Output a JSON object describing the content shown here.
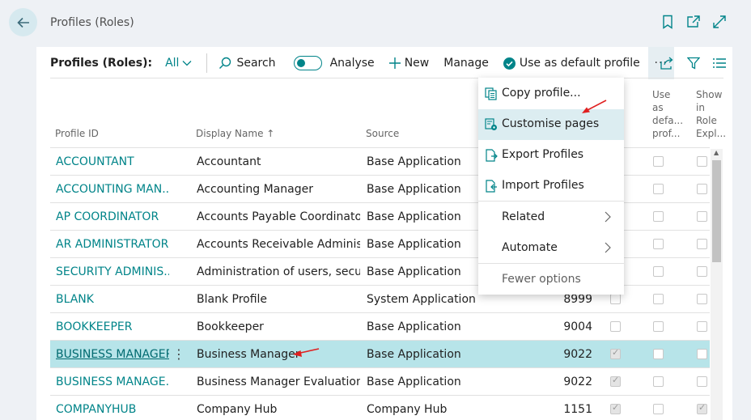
{
  "topbar": {
    "title": "Profiles (Roles)",
    "back_icon": "back-arrow-icon",
    "icons": [
      "bookmark-icon",
      "open-new-window-icon",
      "expand-icon"
    ]
  },
  "actionbar": {
    "title": "Profiles (Roles):",
    "filter": "All",
    "search": "Search",
    "analyse": "Analyse",
    "new": "New",
    "manage": "Manage",
    "use_default": "Use as default profile",
    "more": "···"
  },
  "columns": {
    "profile_id": "Profile ID",
    "display_name": "Display Name",
    "sort_indicator": "↑",
    "source": "Source",
    "use_as_default": [
      "Use",
      "as",
      "defa...",
      "prof..."
    ],
    "show_in_role_explorer": [
      "Show",
      "in",
      "Role",
      "Expl..."
    ]
  },
  "rows": [
    {
      "id": "ACCOUNTANT",
      "name": "Accountant",
      "source": "Base Application",
      "num": "",
      "c1": false,
      "c2": false,
      "c3": false
    },
    {
      "id": "ACCOUNTING MAN...",
      "name": "Accounting Manager",
      "source": "Base Application",
      "num": "",
      "c1": false,
      "c2": false,
      "c3": false
    },
    {
      "id": "AP COORDINATOR",
      "name": "Accounts Payable Coordinator",
      "source": "Base Application",
      "num": "",
      "c1": false,
      "c2": false,
      "c3": false
    },
    {
      "id": "AR ADMINISTRATOR",
      "name": "Accounts Receivable Administr...",
      "source": "Base Application",
      "num": "",
      "c1": false,
      "c2": false,
      "c3": false
    },
    {
      "id": "SECURITY ADMINIS...",
      "name": "Administration of users, securit...",
      "source": "Base Application",
      "num": "",
      "c1": false,
      "c2": false,
      "c3": false
    },
    {
      "id": "BLANK",
      "name": "Blank Profile",
      "source": "System Application",
      "num": "8999",
      "c1": false,
      "c2": false,
      "c3": false
    },
    {
      "id": "BOOKKEEPER",
      "name": "Bookkeeper",
      "source": "Base Application",
      "num": "9004",
      "c1": false,
      "c2": false,
      "c3": false
    },
    {
      "id": "BUSINESS MANAGER",
      "name": "Business Manager",
      "source": "Base Application",
      "num": "9022",
      "c1": true,
      "c2": false,
      "c3": false
    },
    {
      "id": "BUSINESS MANAGE...",
      "name": "Business Manager Evaluation",
      "source": "Base Application",
      "num": "9022",
      "c1": true,
      "c2": false,
      "c3": false
    },
    {
      "id": "COMPANYHUB",
      "name": "Company Hub",
      "source": "Company Hub",
      "num": "1151",
      "c1": true,
      "c2": false,
      "c3": true
    }
  ],
  "menu": {
    "copy_profile": "Copy profile...",
    "customise_pages": "Customise pages",
    "export_profiles": "Export Profiles",
    "import_profiles": "Import Profiles",
    "related": "Related",
    "automate": "Automate",
    "fewer_options": "Fewer options"
  },
  "colors": {
    "accent": "#008489",
    "selected_row": "#b7e4e9",
    "annotation_arrow": "#e02020"
  }
}
